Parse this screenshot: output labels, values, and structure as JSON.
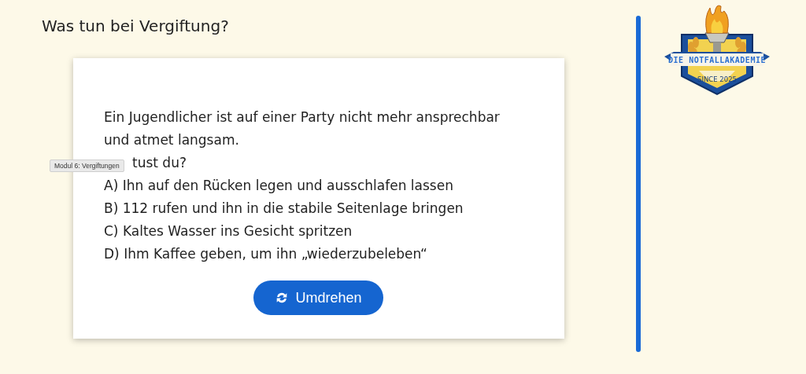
{
  "title": "Was tun bei Vergiftung?",
  "card": {
    "lines": [
      "Ein Jugendlicher ist auf einer Party nicht mehr ansprechbar",
      "und atmet langsam.",
      {
        "kind": "partly-covered",
        "text": "tust du?"
      },
      "A) Ihn auf den Rücken legen und ausschlafen lassen",
      "B) 112 rufen und ihn in die stabile Seitenlage bringen",
      "C) Kaltes Wasser ins Gesicht spritzen",
      "D) Ihm Kaffee geben, um ihn „wiederzubeleben“"
    ],
    "button": "Umdrehen"
  },
  "tooltip": "Modul 6: Vergiftungen",
  "logo": {
    "name": "DIE NOTFALLAKADEMIE",
    "since": "SINCE 2025"
  }
}
